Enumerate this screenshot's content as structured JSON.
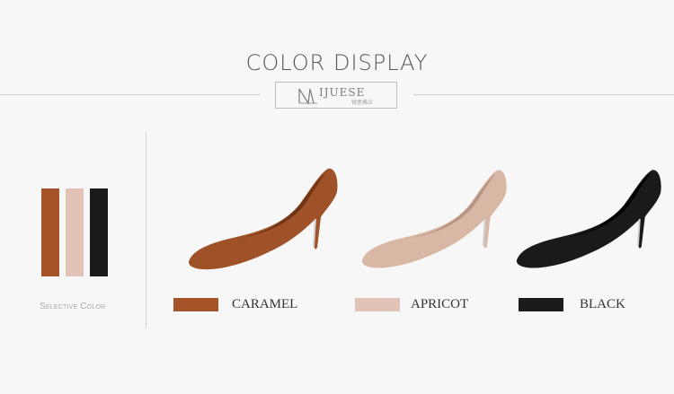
{
  "header": {
    "title": "COLOR DISPLAY",
    "logo_text": "IJUESE",
    "logo_sub": "锐思格兰"
  },
  "sidebar": {
    "label": "Selective Color",
    "swatches": [
      {
        "name": "caramel",
        "color": "#a5542a"
      },
      {
        "name": "apricot",
        "color": "#e0c3b4"
      },
      {
        "name": "black",
        "color": "#1b1b1b"
      }
    ]
  },
  "products": [
    {
      "label": "CARAMEL",
      "color": "#a5542a",
      "shoe_color": "#9f5128",
      "shoe_dark": "#6e3517"
    },
    {
      "label": "APRICOT",
      "color": "#e0c3b4",
      "shoe_color": "#d8b7a5",
      "shoe_dark": "#b79483"
    },
    {
      "label": "BLACK",
      "color": "#1b1b1b",
      "shoe_color": "#1a1a1a",
      "shoe_dark": "#000000"
    }
  ]
}
